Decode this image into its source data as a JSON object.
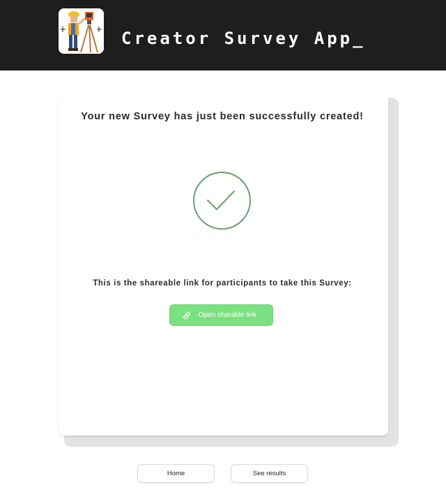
{
  "header": {
    "title": "Creator Survey App_",
    "logo_icon": "surveyor-logo-icon",
    "background": "#1e1e1e"
  },
  "card": {
    "success_message": "Your new Survey has just been successfully created!",
    "success_icon": "check-circle-icon",
    "check_color": "#6a9e6c",
    "share_description": "This is the shareable link for participants to take this Survey:",
    "share_button_label": "Open sharable link",
    "share_button_icon": "link-icon",
    "share_button_color": "#7be07f"
  },
  "footer": {
    "home_label": "Home",
    "results_label": "See results"
  }
}
